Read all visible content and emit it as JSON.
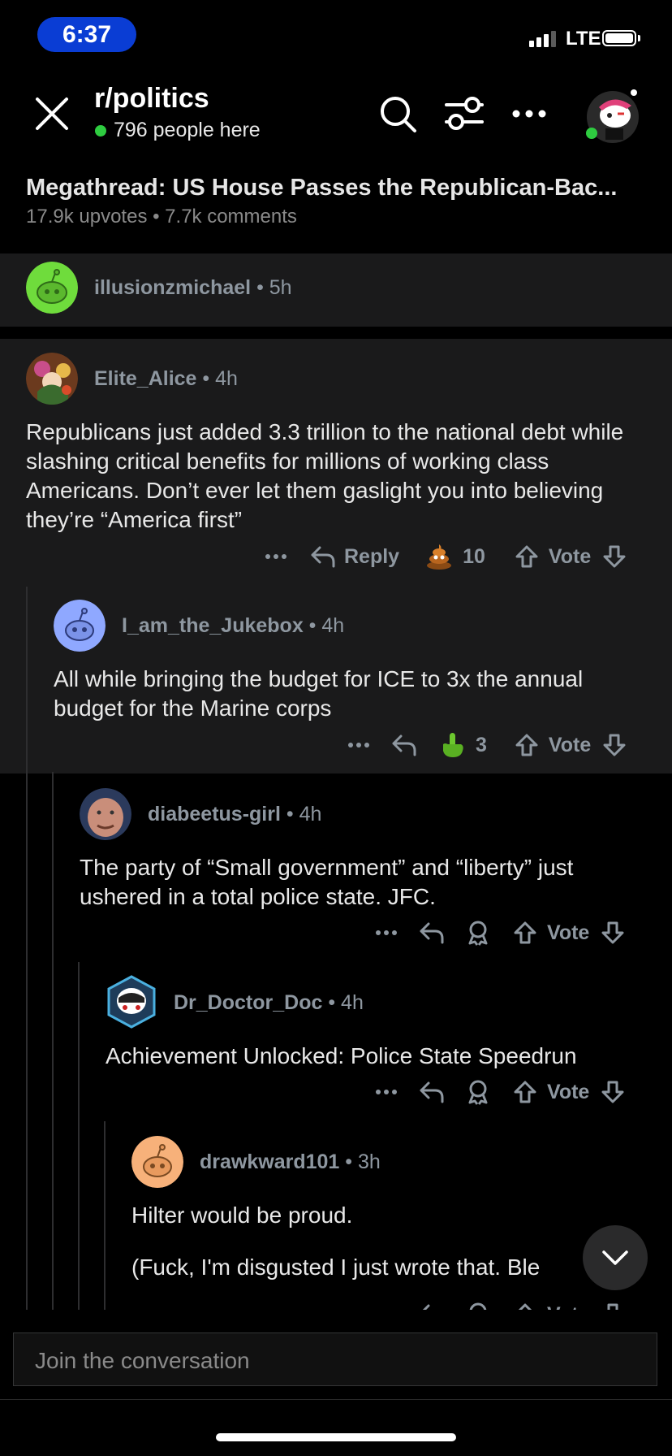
{
  "status_bar": {
    "time": "6:37",
    "network": "LTE"
  },
  "header": {
    "subreddit": "r/politics",
    "online_count": "796 people here"
  },
  "post": {
    "title": "Megathread: US House Passes the Republican-Bac...",
    "meta": "17.9k upvotes • 7.7k comments"
  },
  "comments": [
    {
      "user": "illusionzmichael",
      "age": "5h",
      "collapsed": true
    },
    {
      "user": "Elite_Alice",
      "age": "4h",
      "body": "Republicans just  added 3.3 trillion to the national debt while slashing critical benefits for millions of working class Americans. Don’t ever let them gaslight you into believing they’re “America first”",
      "reply_label": "Reply",
      "award_count": "10",
      "vote_label": "Vote"
    },
    {
      "user": "I_am_the_Jukebox",
      "age": "4h",
      "body": "All while bringing the budget for ICE to 3x the annual budget for the Marine corps",
      "award_count": "3",
      "vote_label": "Vote"
    },
    {
      "user": "diabeetus-girl",
      "age": "4h",
      "body": "The party of “Small government” and “liberty” just ushered in a total police state.  JFC.",
      "vote_label": "Vote"
    },
    {
      "user": "Dr_Doctor_Doc",
      "age": "4h",
      "body": "Achievement Unlocked:  Police State Speedrun",
      "vote_label": "Vote"
    },
    {
      "user": "drawkward101",
      "age": "3h",
      "body": "Hilter would be proud.",
      "body2": "(Fuck, I'm disgusted I just wrote that. Ble",
      "vote_label": "Vote"
    }
  ],
  "composer": {
    "placeholder": "Join the conversation"
  },
  "colors": {
    "accent_pill": "#0a3dd4",
    "online": "#2ecc40",
    "comment_bg": "#1a1a1b"
  }
}
